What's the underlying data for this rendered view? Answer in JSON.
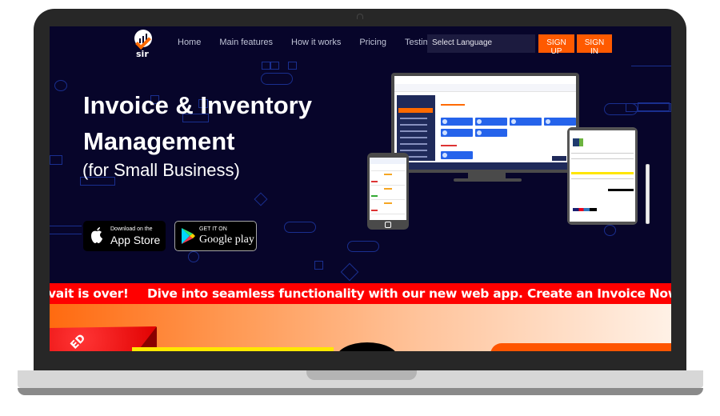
{
  "brand": {
    "logo_text": "sir",
    "logo_icon": "bar-chart-check-icon",
    "accent_color": "#ff5a00",
    "background_color": "#07052a"
  },
  "nav": {
    "links": [
      {
        "label": "Home"
      },
      {
        "label": "Main features"
      },
      {
        "label": "How it works"
      },
      {
        "label": "Pricing"
      },
      {
        "label": "Testimonials"
      }
    ],
    "language_select": "Select Language",
    "signup_label": "SIGN UP",
    "signin_label": "SIGN IN"
  },
  "hero": {
    "title_line1": "Invoice & Inventory",
    "title_line2": "Management",
    "subtitle": "(for Small Business)",
    "appstore": {
      "small": "Download on the",
      "big": "App Store",
      "icon": "apple-icon"
    },
    "googleplay": {
      "small": "GET IT ON",
      "big": "Google play",
      "icon": "google-play-icon"
    }
  },
  "ticker": {
    "items": [
      "vait is over!",
      "Dive into seamless functionality with our new web app.",
      "Create an Invoice Now"
    ],
    "color": "#ff0000"
  },
  "promo": {
    "ribbon_text": "ED"
  }
}
